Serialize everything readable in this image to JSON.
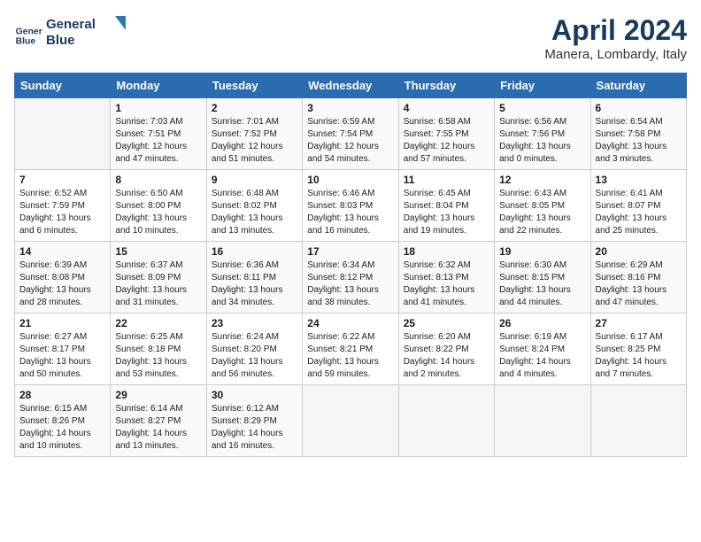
{
  "header": {
    "logo_line1": "General",
    "logo_line2": "Blue",
    "month_title": "April 2024",
    "location": "Manera, Lombardy, Italy"
  },
  "weekdays": [
    "Sunday",
    "Monday",
    "Tuesday",
    "Wednesday",
    "Thursday",
    "Friday",
    "Saturday"
  ],
  "weeks": [
    [
      {
        "day": "",
        "info": ""
      },
      {
        "day": "1",
        "info": "Sunrise: 7:03 AM\nSunset: 7:51 PM\nDaylight: 12 hours\nand 47 minutes."
      },
      {
        "day": "2",
        "info": "Sunrise: 7:01 AM\nSunset: 7:52 PM\nDaylight: 12 hours\nand 51 minutes."
      },
      {
        "day": "3",
        "info": "Sunrise: 6:59 AM\nSunset: 7:54 PM\nDaylight: 12 hours\nand 54 minutes."
      },
      {
        "day": "4",
        "info": "Sunrise: 6:58 AM\nSunset: 7:55 PM\nDaylight: 12 hours\nand 57 minutes."
      },
      {
        "day": "5",
        "info": "Sunrise: 6:56 AM\nSunset: 7:56 PM\nDaylight: 13 hours\nand 0 minutes."
      },
      {
        "day": "6",
        "info": "Sunrise: 6:54 AM\nSunset: 7:58 PM\nDaylight: 13 hours\nand 3 minutes."
      }
    ],
    [
      {
        "day": "7",
        "info": "Sunrise: 6:52 AM\nSunset: 7:59 PM\nDaylight: 13 hours\nand 6 minutes."
      },
      {
        "day": "8",
        "info": "Sunrise: 6:50 AM\nSunset: 8:00 PM\nDaylight: 13 hours\nand 10 minutes."
      },
      {
        "day": "9",
        "info": "Sunrise: 6:48 AM\nSunset: 8:02 PM\nDaylight: 13 hours\nand 13 minutes."
      },
      {
        "day": "10",
        "info": "Sunrise: 6:46 AM\nSunset: 8:03 PM\nDaylight: 13 hours\nand 16 minutes."
      },
      {
        "day": "11",
        "info": "Sunrise: 6:45 AM\nSunset: 8:04 PM\nDaylight: 13 hours\nand 19 minutes."
      },
      {
        "day": "12",
        "info": "Sunrise: 6:43 AM\nSunset: 8:05 PM\nDaylight: 13 hours\nand 22 minutes."
      },
      {
        "day": "13",
        "info": "Sunrise: 6:41 AM\nSunset: 8:07 PM\nDaylight: 13 hours\nand 25 minutes."
      }
    ],
    [
      {
        "day": "14",
        "info": "Sunrise: 6:39 AM\nSunset: 8:08 PM\nDaylight: 13 hours\nand 28 minutes."
      },
      {
        "day": "15",
        "info": "Sunrise: 6:37 AM\nSunset: 8:09 PM\nDaylight: 13 hours\nand 31 minutes."
      },
      {
        "day": "16",
        "info": "Sunrise: 6:36 AM\nSunset: 8:11 PM\nDaylight: 13 hours\nand 34 minutes."
      },
      {
        "day": "17",
        "info": "Sunrise: 6:34 AM\nSunset: 8:12 PM\nDaylight: 13 hours\nand 38 minutes."
      },
      {
        "day": "18",
        "info": "Sunrise: 6:32 AM\nSunset: 8:13 PM\nDaylight: 13 hours\nand 41 minutes."
      },
      {
        "day": "19",
        "info": "Sunrise: 6:30 AM\nSunset: 8:15 PM\nDaylight: 13 hours\nand 44 minutes."
      },
      {
        "day": "20",
        "info": "Sunrise: 6:29 AM\nSunset: 8:16 PM\nDaylight: 13 hours\nand 47 minutes."
      }
    ],
    [
      {
        "day": "21",
        "info": "Sunrise: 6:27 AM\nSunset: 8:17 PM\nDaylight: 13 hours\nand 50 minutes."
      },
      {
        "day": "22",
        "info": "Sunrise: 6:25 AM\nSunset: 8:18 PM\nDaylight: 13 hours\nand 53 minutes."
      },
      {
        "day": "23",
        "info": "Sunrise: 6:24 AM\nSunset: 8:20 PM\nDaylight: 13 hours\nand 56 minutes."
      },
      {
        "day": "24",
        "info": "Sunrise: 6:22 AM\nSunset: 8:21 PM\nDaylight: 13 hours\nand 59 minutes."
      },
      {
        "day": "25",
        "info": "Sunrise: 6:20 AM\nSunset: 8:22 PM\nDaylight: 14 hours\nand 2 minutes."
      },
      {
        "day": "26",
        "info": "Sunrise: 6:19 AM\nSunset: 8:24 PM\nDaylight: 14 hours\nand 4 minutes."
      },
      {
        "day": "27",
        "info": "Sunrise: 6:17 AM\nSunset: 8:25 PM\nDaylight: 14 hours\nand 7 minutes."
      }
    ],
    [
      {
        "day": "28",
        "info": "Sunrise: 6:15 AM\nSunset: 8:26 PM\nDaylight: 14 hours\nand 10 minutes."
      },
      {
        "day": "29",
        "info": "Sunrise: 6:14 AM\nSunset: 8:27 PM\nDaylight: 14 hours\nand 13 minutes."
      },
      {
        "day": "30",
        "info": "Sunrise: 6:12 AM\nSunset: 8:29 PM\nDaylight: 14 hours\nand 16 minutes."
      },
      {
        "day": "",
        "info": ""
      },
      {
        "day": "",
        "info": ""
      },
      {
        "day": "",
        "info": ""
      },
      {
        "day": "",
        "info": ""
      }
    ]
  ]
}
